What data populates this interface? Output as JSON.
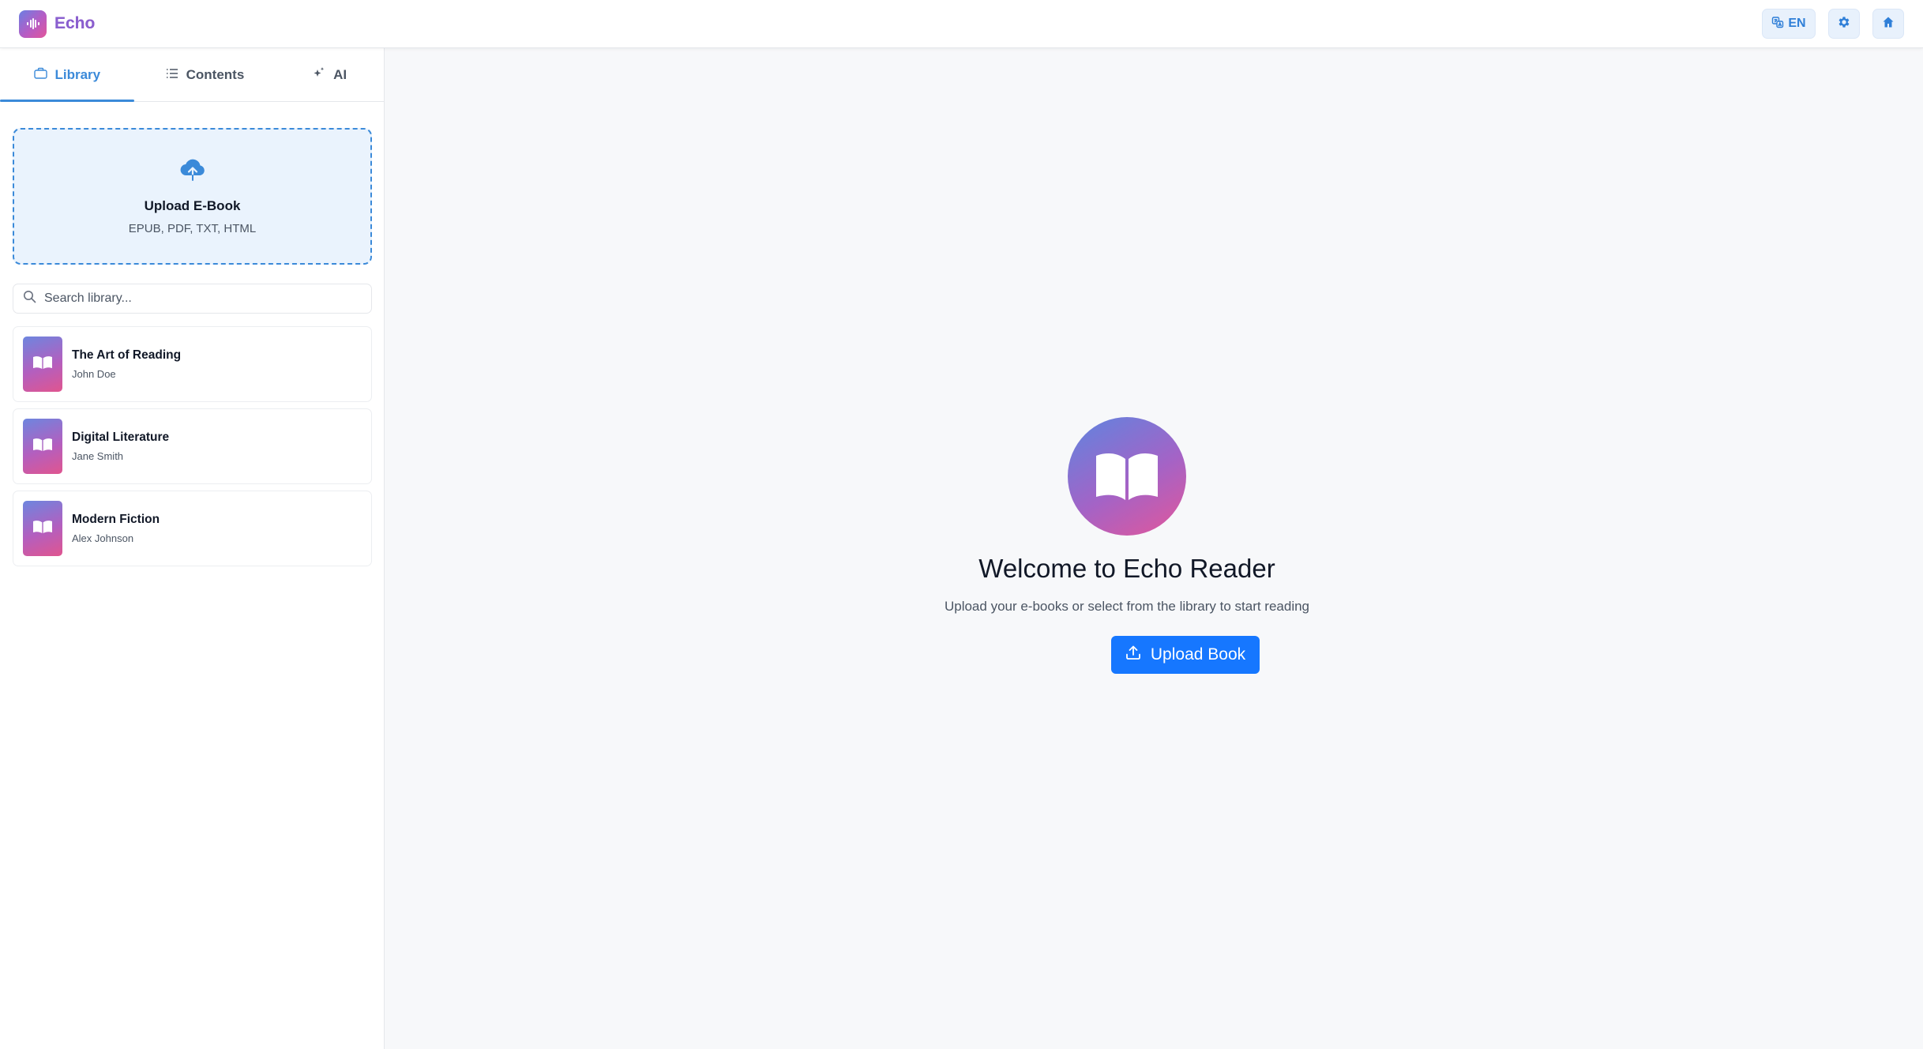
{
  "app": {
    "name": "Echo"
  },
  "header": {
    "language_label": "EN",
    "icons": {
      "language": "translate-icon",
      "settings": "gear-icon",
      "home": "home-icon"
    }
  },
  "sidebar": {
    "tabs": [
      {
        "label": "Library",
        "icon": "briefcase-icon",
        "active": true
      },
      {
        "label": "Contents",
        "icon": "list-icon",
        "active": false
      },
      {
        "label": "AI",
        "icon": "sparkle-icon",
        "active": false
      }
    ],
    "upload": {
      "title": "Upload E-Book",
      "formats": "EPUB, PDF, TXT, HTML"
    },
    "search": {
      "placeholder": "Search library...",
      "value": ""
    },
    "books": [
      {
        "title": "The Art of Reading",
        "author": "John Doe"
      },
      {
        "title": "Digital Literature",
        "author": "Jane Smith"
      },
      {
        "title": "Modern Fiction",
        "author": "Alex Johnson"
      }
    ]
  },
  "main": {
    "welcome_title": "Welcome to Echo Reader",
    "welcome_subtitle": "Upload your e-books or select from the library to start reading",
    "upload_button_label": "Upload Book"
  },
  "colors": {
    "accent": "#3b8ad9",
    "primary_button": "#1677ff",
    "gradient_start": "#6b7fe3",
    "gradient_end": "#e2569a"
  }
}
